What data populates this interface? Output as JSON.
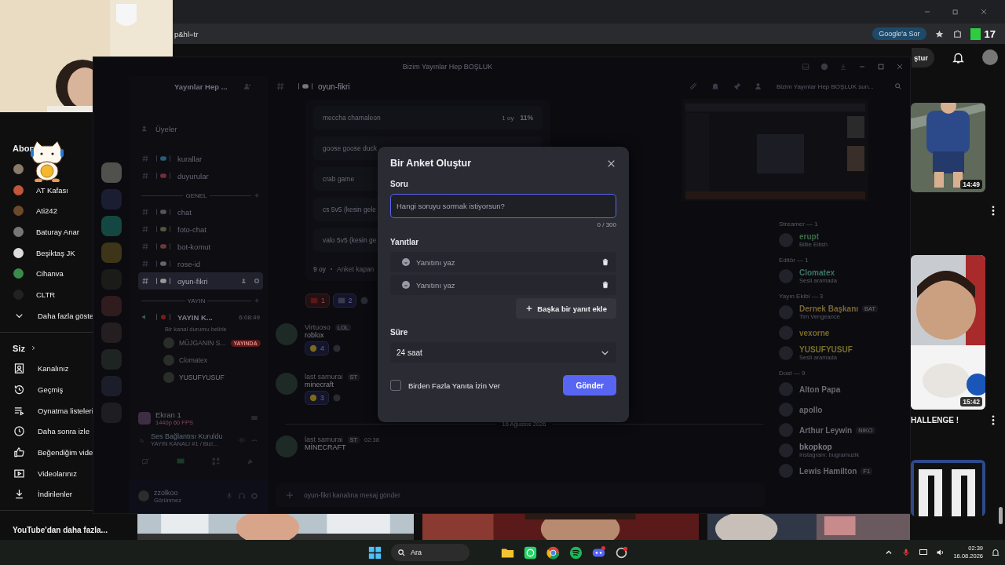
{
  "browser": {
    "address_fragment": "p&hl=tr",
    "ask_google_button": "Google'a Sor",
    "extension_badge": "17"
  },
  "youtube": {
    "create_button_fragment": "ştur",
    "subscriptions_heading": "Abon",
    "subscriptions": [
      "AT Kafası",
      "Ati242",
      "Baturay Anar",
      "Beşiktaş JK",
      "Cihanva",
      "CLTR"
    ],
    "show_more": "Daha fazla göste",
    "you_heading": "Siz",
    "you_items": [
      "Kanalınız",
      "Geçmiş",
      "Oynatma listeleri",
      "Daha sonra izle",
      "Beğendiğim vide",
      "Videolarınız",
      "İndirilenler"
    ],
    "more_from_youtube": "YouTube'dan daha fazla...",
    "videos": [
      {
        "duration": "14:49"
      },
      {
        "duration": "15:42",
        "title": "HALLENGE !"
      }
    ]
  },
  "discord": {
    "window_title": "Bizim Yayınlar Hep BOŞLUK",
    "server_name": "Yayınlar Hep ...",
    "channel_title": "oyun-fikri",
    "search_placeholder": "Bizim Yayınlar Hep BOŞLUK sun...",
    "members_link": "Üyeler",
    "channels": [
      {
        "kind": "text",
        "name": "kurallar",
        "selected": false
      },
      {
        "kind": "text",
        "name": "duyurular",
        "selected": false
      },
      {
        "kind": "category",
        "name": "GENEL",
        "selected": false
      },
      {
        "kind": "text",
        "name": "chat",
        "selected": false
      },
      {
        "kind": "text",
        "name": "foto-chat",
        "selected": false
      },
      {
        "kind": "text",
        "name": "bot-komut",
        "selected": false
      },
      {
        "kind": "text",
        "name": "rose-id",
        "selected": false
      },
      {
        "kind": "text",
        "name": "oyun-fikri",
        "selected": true
      },
      {
        "kind": "category",
        "name": "YAYIN",
        "selected": false
      },
      {
        "kind": "voice",
        "name": "YAYIN K...",
        "time": "6:08:49",
        "status": "Bir kanal durumu belirle",
        "selected": false
      }
    ],
    "voice_users": [
      {
        "name": "MÜJGANIN S...",
        "badge": "YAYINDA"
      },
      {
        "name": "Clomatex"
      },
      {
        "name": "YUSUFYUSUF"
      }
    ],
    "stream": {
      "title": "Ekran 1",
      "quality": "1440p 60 FPS"
    },
    "voice": {
      "status": "Ses Bağlantısı Kuruldu",
      "channel": "YAYIN KANALI #1 / Bizi..."
    },
    "user": {
      "name": "zzolkoo",
      "status": "Görünmez"
    },
    "poll": {
      "options": [
        {
          "text": "meccha chamaleon",
          "votes": "1 oy",
          "percent": "11%"
        },
        {
          "text": "goose goose duck"
        },
        {
          "text": "crab game"
        },
        {
          "text": "cs 5v5 (kesin gele"
        },
        {
          "text": "valo 5v5 (kesin ge"
        }
      ],
      "total": "9 oy",
      "closing": "Anket kapan",
      "reactions": [
        "1",
        "2"
      ]
    },
    "messages": [
      {
        "author": "Virtuoso",
        "tag": "LOL",
        "text": "roblox",
        "reaction": "4"
      },
      {
        "author": "last samurai",
        "tag": "ST",
        "text": "minecraft",
        "reaction": "3"
      }
    ],
    "date_divider": "16 Ağustos 2026",
    "later_messages": [
      {
        "author": "last samurai",
        "tag": "ST",
        "time": "02:38",
        "text": "MİNECRAFT"
      }
    ],
    "message_placeholder": "oyun-fikri kanalına mesaj gönder",
    "member_groups": [
      {
        "title": "Streamer — 1",
        "members": [
          {
            "name": "erupt",
            "activity": "Billie Eilish",
            "color": "#3d6b47"
          }
        ]
      },
      {
        "title": "Editör — 1",
        "members": [
          {
            "name": "Clomatex",
            "activity": "Sesli aramada",
            "color": "#3f7565"
          }
        ]
      },
      {
        "title": "Yayın Ekibi — 3",
        "members": [
          {
            "name": "Dernek Başkanı",
            "tag": "BAT",
            "activity": "Tim Vengeance",
            "color": "#7a6535"
          },
          {
            "name": "vexorne",
            "color": "#7a6a25"
          },
          {
            "name": "YUSUFYUSUF",
            "activity": "Sesli aramada",
            "color": "#7a7028"
          }
        ]
      },
      {
        "title": "Dost — 9",
        "members": [
          {
            "name": "Alton Papa",
            "color": "#6a6a72"
          },
          {
            "name": "apollo",
            "color": "#6a6a72"
          },
          {
            "name": "Arthur Leywin",
            "tag": "NIKO",
            "color": "#6a6a72"
          },
          {
            "name": "bkopkop",
            "activity": "Instagram: bugramuzik",
            "color": "#7a7a84"
          },
          {
            "name": "Lewis Hamilton",
            "tag": "F1",
            "color": "#6a6a72"
          }
        ]
      }
    ]
  },
  "poll_modal": {
    "title": "Bir Anket Oluştur",
    "question_label": "Soru",
    "question_placeholder": "Hangi soruyu sormak istiyorsun?",
    "counter": "0 / 300",
    "answers_label": "Yanıtlar",
    "answers": [
      {
        "placeholder": "Yanıtını yaz"
      },
      {
        "placeholder": "Yanıtını yaz"
      }
    ],
    "add_answer": "Başka bir yanıt ekle",
    "duration_label": "Süre",
    "duration": "24 saat",
    "multiple_answers": {
      "label": "Birden Fazla Yanıta İzin Ver",
      "checked": false
    },
    "submit": "Gönder"
  },
  "taskbar": {
    "search": "Ara",
    "time": "02:39",
    "date": "16.08.2026"
  }
}
